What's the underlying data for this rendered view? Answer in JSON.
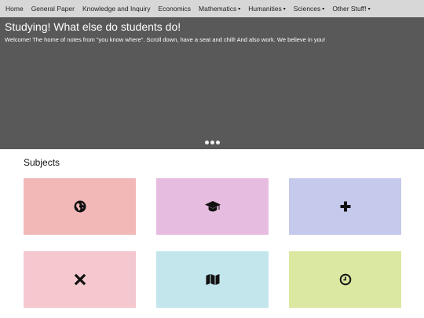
{
  "nav": {
    "items": [
      {
        "label": "Home",
        "dropdown": false
      },
      {
        "label": "General Paper",
        "dropdown": false
      },
      {
        "label": "Knowledge and Inquiry",
        "dropdown": false
      },
      {
        "label": "Economics",
        "dropdown": false
      },
      {
        "label": "Mathematics",
        "dropdown": true
      },
      {
        "label": "Humanities",
        "dropdown": true
      },
      {
        "label": "Sciences",
        "dropdown": true
      },
      {
        "label": "Other Stuff!",
        "dropdown": true
      }
    ],
    "caret": "▾"
  },
  "hero": {
    "title": "Studying! What else do students do!",
    "subtitle": "Welcome! The home of notes from \"you know where\". Scroll down, have a seat and chill! And also work. We believe in you!",
    "slide_count": 3
  },
  "subjects": {
    "heading": "Subjects",
    "tiles": [
      {
        "icon": "globe-icon",
        "color": "#f2b8b8"
      },
      {
        "icon": "graduation-cap-icon",
        "color": "#e6bde0"
      },
      {
        "icon": "plus-icon",
        "color": "#c5c9ec"
      },
      {
        "icon": "times-icon",
        "color": "#f5c8d0"
      },
      {
        "icon": "map-icon",
        "color": "#c3e6ec"
      },
      {
        "icon": "clock-icon",
        "color": "#dbe8a2"
      }
    ]
  }
}
